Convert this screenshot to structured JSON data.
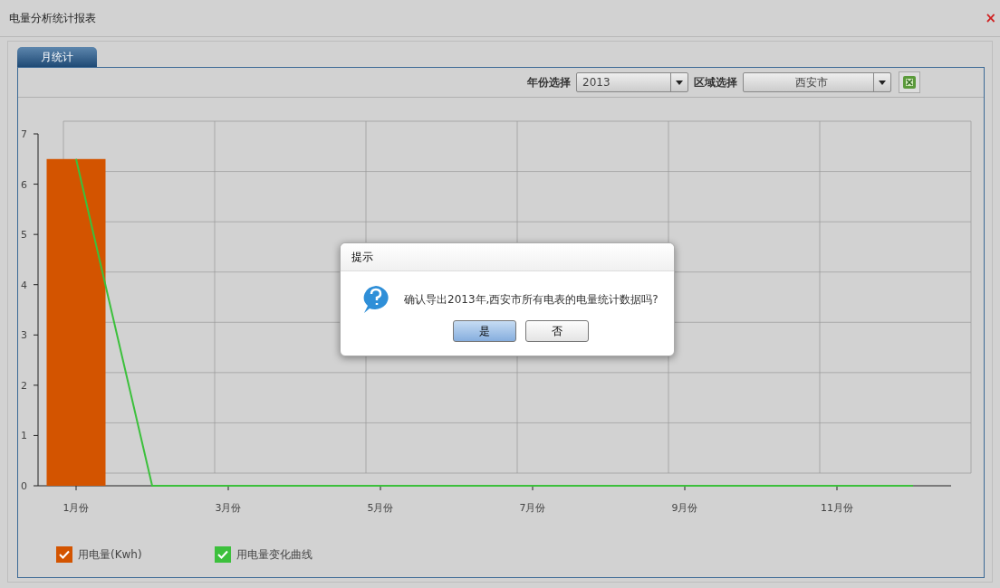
{
  "window": {
    "title": "电量分析统计报表",
    "close": "×"
  },
  "tabs": [
    {
      "label": "月统计",
      "selected": true
    }
  ],
  "toolbar": {
    "year_label": "年份选择",
    "year_value": "2013",
    "area_label": "区域选择",
    "area_value": "西安市"
  },
  "chart": {
    "chart_data": {
      "type": "bar",
      "x": [
        1,
        2,
        3,
        4,
        5,
        6,
        7,
        8,
        9,
        10,
        11,
        12
      ],
      "xlim": [
        0.5,
        12.5
      ],
      "xticks": [
        {
          "value": 1,
          "label": "1月份"
        },
        {
          "value": 3,
          "label": "3月份"
        },
        {
          "value": 5,
          "label": "5月份"
        },
        {
          "value": 7,
          "label": "7月份"
        },
        {
          "value": 9,
          "label": "9月份"
        },
        {
          "value": 11,
          "label": "11月份"
        }
      ],
      "ylim": [
        0,
        7
      ],
      "yticks": [
        0,
        1,
        2,
        3,
        4,
        5,
        6,
        7
      ],
      "series": [
        {
          "name": "用电量(Kwh)",
          "type": "bar",
          "color": "#d35400",
          "values": [
            6.5,
            0,
            0,
            0,
            0,
            0,
            0,
            0,
            0,
            0,
            0,
            0
          ]
        },
        {
          "name": "用电量变化曲线",
          "type": "line",
          "color": "#3cc03c",
          "values": [
            6.5,
            0,
            0,
            0,
            0,
            0,
            0,
            0,
            0,
            0,
            0,
            0
          ]
        }
      ]
    }
  },
  "legend": [
    {
      "checked": true
    },
    {
      "checked": true
    }
  ],
  "dialog": {
    "title": "提示",
    "message": "确认导出2013年,西安市所有电表的电量统计数据吗?",
    "buttons": [
      {
        "label": "是",
        "selected": true
      },
      {
        "label": "否",
        "selected": false
      }
    ]
  }
}
